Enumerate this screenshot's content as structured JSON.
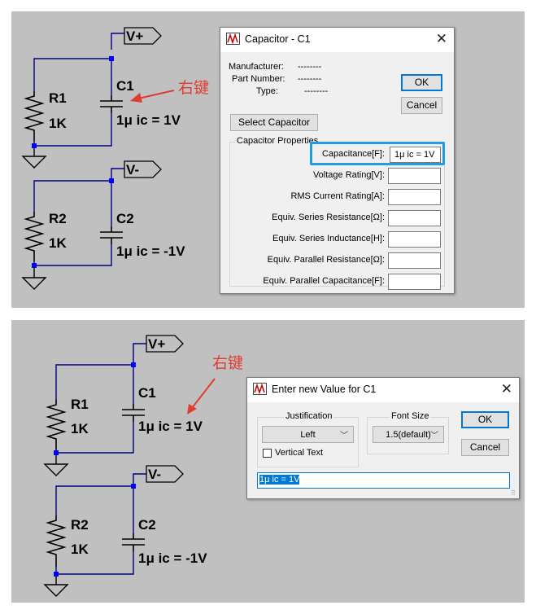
{
  "schematic_top": {
    "nodes": {
      "vplus": "V+",
      "vminus": "V-"
    },
    "r1": {
      "name": "R1",
      "value": "1K"
    },
    "c1": {
      "name": "C1",
      "value": "1μ ic = 1V"
    },
    "r2": {
      "name": "R2",
      "value": "1K"
    },
    "c2": {
      "name": "C2",
      "value": "1μ ic = -1V"
    },
    "annotation": "右键"
  },
  "schematic_bottom": {
    "nodes": {
      "vplus": "V+",
      "vminus": "V-"
    },
    "r1": {
      "name": "R1",
      "value": "1K"
    },
    "c1": {
      "name": "C1",
      "value": "1μ ic = 1V"
    },
    "r2": {
      "name": "R2",
      "value": "1K"
    },
    "c2": {
      "name": "C2",
      "value": "1μ ic = -1V"
    },
    "annotation": "右键"
  },
  "capacitor_dialog": {
    "title": "Capacitor - C1",
    "manufacturer_label": "Manufacturer:",
    "manufacturer_value": "--------",
    "part_number_label": "Part Number:",
    "part_number_value": "--------",
    "type_label": "Type:",
    "type_value": "--------",
    "ok_label": "OK",
    "cancel_label": "Cancel",
    "select_button": "Select Capacitor",
    "group_title": "Capacitor Properties",
    "fields": [
      {
        "label": "Capacitance[F]:",
        "value": "1μ ic = 1V"
      },
      {
        "label": "Voltage Rating[V]:",
        "value": ""
      },
      {
        "label": "RMS Current Rating[A]:",
        "value": ""
      },
      {
        "label": "Equiv. Series Resistance[Ω]:",
        "value": ""
      },
      {
        "label": "Equiv. Series Inductance[H]:",
        "value": ""
      },
      {
        "label": "Equiv. Parallel Resistance[Ω]:",
        "value": ""
      },
      {
        "label": "Equiv. Parallel Capacitance[F]:",
        "value": ""
      }
    ]
  },
  "value_dialog": {
    "title": "Enter new Value for C1",
    "justification_title": "Justification",
    "justification_value": "Left",
    "vertical_text_label": "Vertical Text",
    "font_size_title": "Font Size",
    "font_size_value": "1.5(default)",
    "ok_label": "OK",
    "cancel_label": "Cancel",
    "input_value": "1μ ic = 1V"
  },
  "colors": {
    "panel_bg": "#c0c0c0",
    "wire": "#000080",
    "junction": "#0000ff",
    "annotation_red": "#e03c31",
    "highlight_blue": "#1e9de0"
  }
}
